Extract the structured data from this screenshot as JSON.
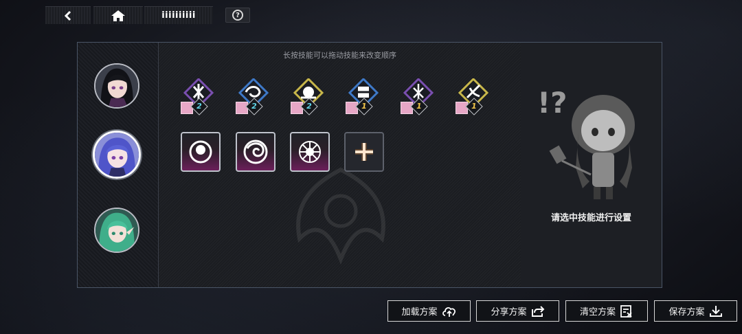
{
  "topbar": {
    "title": "iiiiiiiiii",
    "help": "?"
  },
  "panel": {
    "hint": "长按技能可以拖动技能来改变顺序",
    "empty_message": "请选中技能进行设置"
  },
  "characters": [
    {
      "name": "character-1",
      "selected": false
    },
    {
      "name": "character-2",
      "selected": true
    },
    {
      "name": "character-3",
      "selected": false
    }
  ],
  "skills": [
    {
      "frame_color": "#7a4fb0",
      "count": "2",
      "count_color": "#5fd3e6"
    },
    {
      "frame_color": "#3e79c8",
      "count": "2",
      "count_color": "#5fd3e6"
    },
    {
      "frame_color": "#c8b74a",
      "count": "2",
      "count_color": "#5fd3e6"
    },
    {
      "frame_color": "#3e79c8",
      "count": "1",
      "count_color": "#f2c64a"
    },
    {
      "frame_color": "#7a4fb0",
      "count": "1",
      "count_color": "#f2c64a"
    },
    {
      "frame_color": "#c8b74a",
      "count": "1",
      "count_color": "#f2c64a"
    }
  ],
  "slots": [
    {
      "icon": "orb-icon"
    },
    {
      "icon": "swirl-icon"
    },
    {
      "icon": "thorn-icon"
    },
    {
      "icon": "plus-icon"
    }
  ],
  "buttons": {
    "load": "加载方案",
    "share": "分享方案",
    "clear": "清空方案",
    "save": "保存方案"
  }
}
